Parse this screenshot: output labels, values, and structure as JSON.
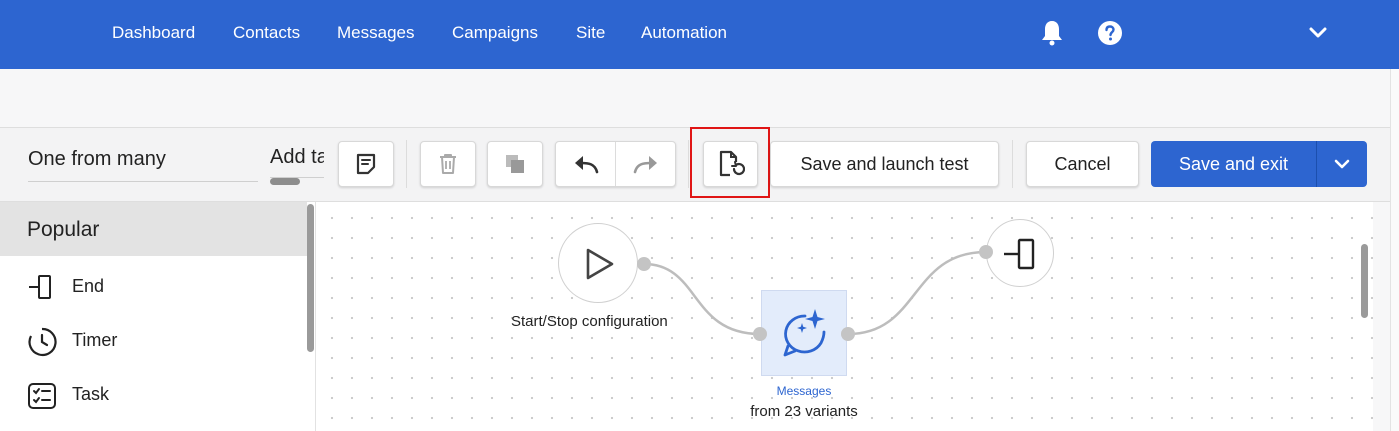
{
  "nav": {
    "items": [
      "Dashboard",
      "Contacts",
      "Messages",
      "Campaigns",
      "Site",
      "Automation"
    ],
    "icons": [
      "bell-icon",
      "help-icon",
      "chevron-down-icon"
    ],
    "color": "#2d65d0"
  },
  "toolbar": {
    "automation_name": "One from many",
    "add_tag_label": "Add tag",
    "icons": [
      "note-icon",
      "trash-icon",
      "copy-icon",
      "undo-icon",
      "redo-icon",
      "restore-version-icon"
    ],
    "launch_test_label": "Save and launch test",
    "cancel_label": "Cancel",
    "save_exit_label": "Save and exit"
  },
  "sidebar": {
    "section_title": "Popular",
    "items": [
      {
        "label": "End",
        "icon": "end-icon"
      },
      {
        "label": "Timer",
        "icon": "timer-icon"
      },
      {
        "label": "Task",
        "icon": "task-icon"
      }
    ]
  },
  "canvas": {
    "start_node_label": "Start/Stop configuration",
    "message_node_caption": "Messages",
    "message_node_subtitle": "from 23 variants",
    "end_node_icon": "end-icon"
  },
  "colors": {
    "accent": "#2d65d0",
    "highlight": "#e01515"
  }
}
